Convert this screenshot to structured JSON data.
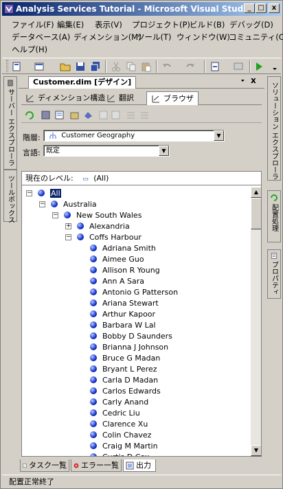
{
  "window": {
    "title": "Analysis Services Tutorial - Microsoft Visual Studio",
    "min": "_",
    "max": "□",
    "close": "x"
  },
  "menu": [
    "ファイル(F)",
    "編集(E)",
    "表示(V)",
    "プロジェクト(P)",
    "ビルド(B)",
    "デバッグ(D)",
    "データベース(A)",
    "ディメンション(M)",
    "ツール(T)",
    "ウィンドウ(W)",
    "コミュニティ(C)",
    "ヘルプ(H)"
  ],
  "left_panels": {
    "server_explorer": "サーバー エクスプローラ",
    "toolbox": "ツールボックス"
  },
  "right_panels": {
    "solution_explorer": "ソリューション エクスプローラ",
    "deploy": "配置処理",
    "properties": "プロパティ"
  },
  "document": {
    "tab": "Customer.dim [デザイン]",
    "close": "x",
    "design_tabs": [
      "ディメンション構造",
      "翻訳",
      "ブラウザ"
    ],
    "hierarchy_label": "階層:",
    "hierarchy_value": "Customer Geography",
    "language_label": "言語:",
    "language_value": "既定",
    "level_label": "現在のレベル:",
    "level_value": "(All)"
  },
  "tree": {
    "root": "All",
    "country": "Australia",
    "state": "New South Wales",
    "city1": "Alexandria",
    "city2": "Coffs Harbour",
    "customers": [
      "Adriana Smith",
      "Aimee Guo",
      "Allison R Young",
      "Ann A Sara",
      "Antonio G Patterson",
      "Ariana Stewart",
      "Arthur Kapoor",
      "Barbara W Lal",
      "Bobby D Saunders",
      "Brianna J Johnson",
      "Bruce G Madan",
      "Bryant L Perez",
      "Carla D Madan",
      "Carlos Edwards",
      "Carly Anand",
      "Cedric Liu",
      "Clarence Xu",
      "Colin Chavez",
      "Craig M Martin",
      "Curtis D Cox"
    ]
  },
  "bottom_tabs": [
    "タスク一覧",
    "エラー一覧",
    "出力"
  ],
  "status": "配置正常終了",
  "colors": {
    "title_start": "#0a246a",
    "title_end": "#a6caf0",
    "face": "#d4d0c8",
    "selection": "#0a246a"
  }
}
